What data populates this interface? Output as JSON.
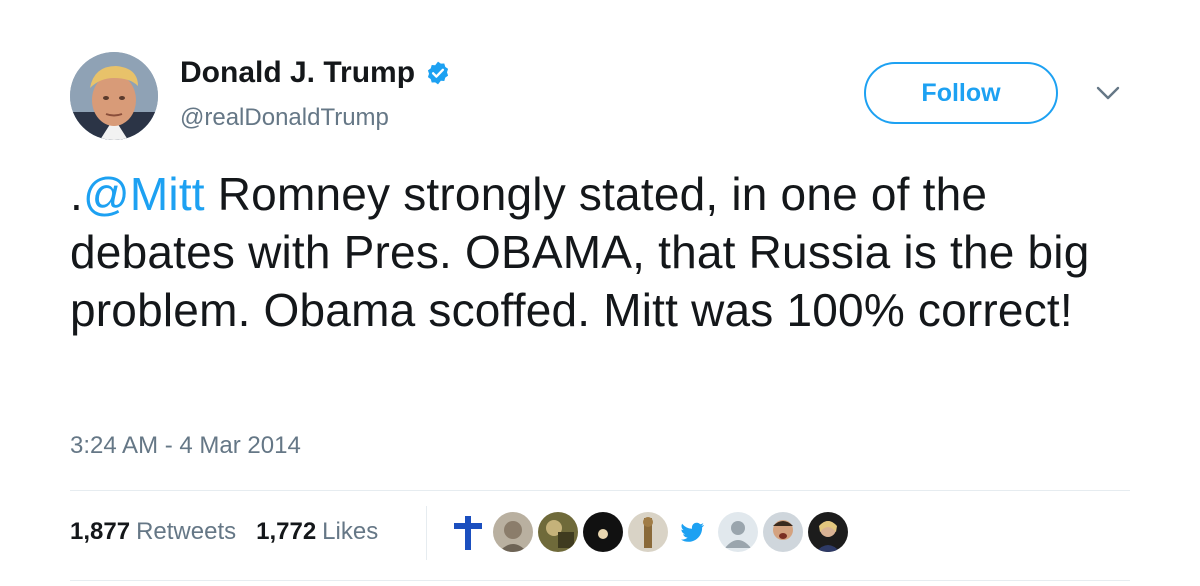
{
  "author": {
    "display_name": "Donald J. Trump",
    "handle": "@realDonaldTrump",
    "verified": true,
    "avatar_icon": "profile-photo"
  },
  "follow_button": {
    "label": "Follow"
  },
  "menu": {
    "icon": "chevron-down-icon"
  },
  "tweet": {
    "prefix": ".",
    "mention": "@Mitt",
    "body": " Romney strongly stated, in one of the debates with Pres. OBAMA, that Russia is the big problem. Obama scoffed. Mitt was 100% correct!",
    "timestamp": "3:24 AM - 4 Mar 2014"
  },
  "stats": {
    "retweets_count": "1,877",
    "retweets_label": "Retweets",
    "likes_count": "1,772",
    "likes_label": "Likes"
  },
  "liker_avatars": [
    {
      "icon": "cross-icon"
    },
    {
      "icon": "avatar-photo"
    },
    {
      "icon": "avatar-photo"
    },
    {
      "icon": "avatar-photo"
    },
    {
      "icon": "avatar-photo"
    },
    {
      "icon": "twitter-bird-icon"
    },
    {
      "icon": "default-avatar-icon"
    },
    {
      "icon": "avatar-photo"
    },
    {
      "icon": "avatar-photo"
    }
  ],
  "colors": {
    "accent": "#1da1f2",
    "text_primary": "#14171a",
    "text_secondary": "#657786",
    "divider": "#e6ecf0"
  }
}
